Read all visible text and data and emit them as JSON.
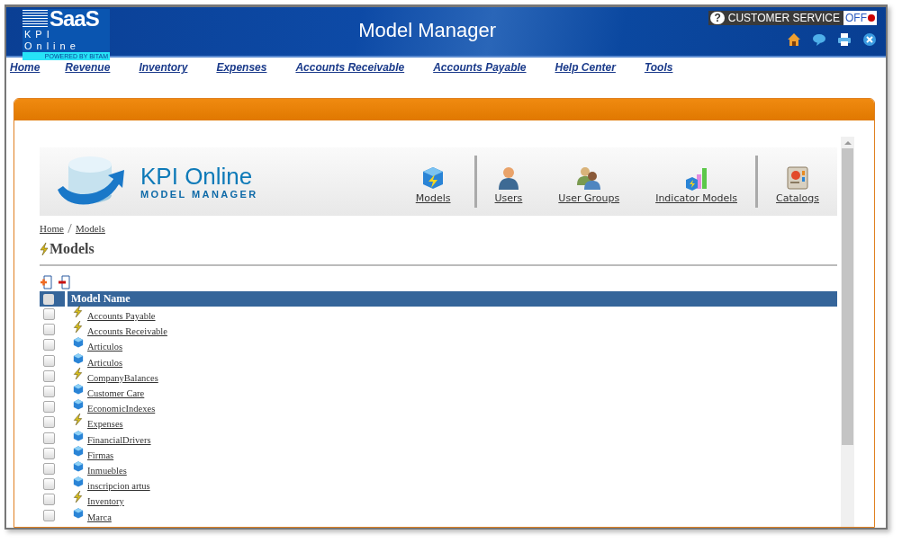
{
  "header": {
    "logo_main": "SaaS",
    "logo_sub": "KPI Online",
    "logo_tag": "POWERED BY BITAM",
    "title": "Model Manager",
    "customer_service": {
      "icon": "?",
      "label": "CUSTOMER SERVICE",
      "status": "OFF"
    }
  },
  "nav": [
    "Home",
    "Revenue",
    "Inventory",
    "Expenses",
    "Accounts Receivable",
    "Accounts Payable",
    "Help Center",
    "Tools"
  ],
  "banner": {
    "brand": "KPI Online",
    "subtitle": "MODEL MANAGER",
    "groups": [
      [
        {
          "label": "Models",
          "kind": "models"
        }
      ],
      [
        {
          "label": "Users",
          "kind": "users"
        },
        {
          "label": "User Groups",
          "kind": "groups"
        },
        {
          "label": "Indicator Models",
          "kind": "indicators"
        }
      ],
      [
        {
          "label": "Catalogs",
          "kind": "catalogs"
        }
      ]
    ]
  },
  "breadcrumb": [
    "Home",
    "Models"
  ],
  "page_title": "Models",
  "table": {
    "all_checked": false,
    "columns": [
      "Model Name"
    ],
    "rows": [
      {
        "name": "Accounts Payable",
        "kind": "measure",
        "checked": false
      },
      {
        "name": "Accounts Receivable",
        "kind": "measure",
        "checked": false
      },
      {
        "name": "Articulos",
        "kind": "cube",
        "checked": false
      },
      {
        "name": "Articulos",
        "kind": "cube",
        "checked": false
      },
      {
        "name": "CompanyBalances",
        "kind": "measure",
        "checked": false
      },
      {
        "name": "Customer Care",
        "kind": "cube",
        "checked": false
      },
      {
        "name": "EconomicIndexes",
        "kind": "cube",
        "checked": false
      },
      {
        "name": "Expenses",
        "kind": "measure",
        "checked": false
      },
      {
        "name": "FinancialDrivers",
        "kind": "cube",
        "checked": false
      },
      {
        "name": "Firmas",
        "kind": "cube",
        "checked": false
      },
      {
        "name": "Inmuebles",
        "kind": "cube",
        "checked": false
      },
      {
        "name": "inscripcion artus",
        "kind": "cube",
        "checked": false
      },
      {
        "name": "Inventory",
        "kind": "measure",
        "checked": false
      },
      {
        "name": "Marca",
        "kind": "cube",
        "checked": false
      }
    ]
  }
}
